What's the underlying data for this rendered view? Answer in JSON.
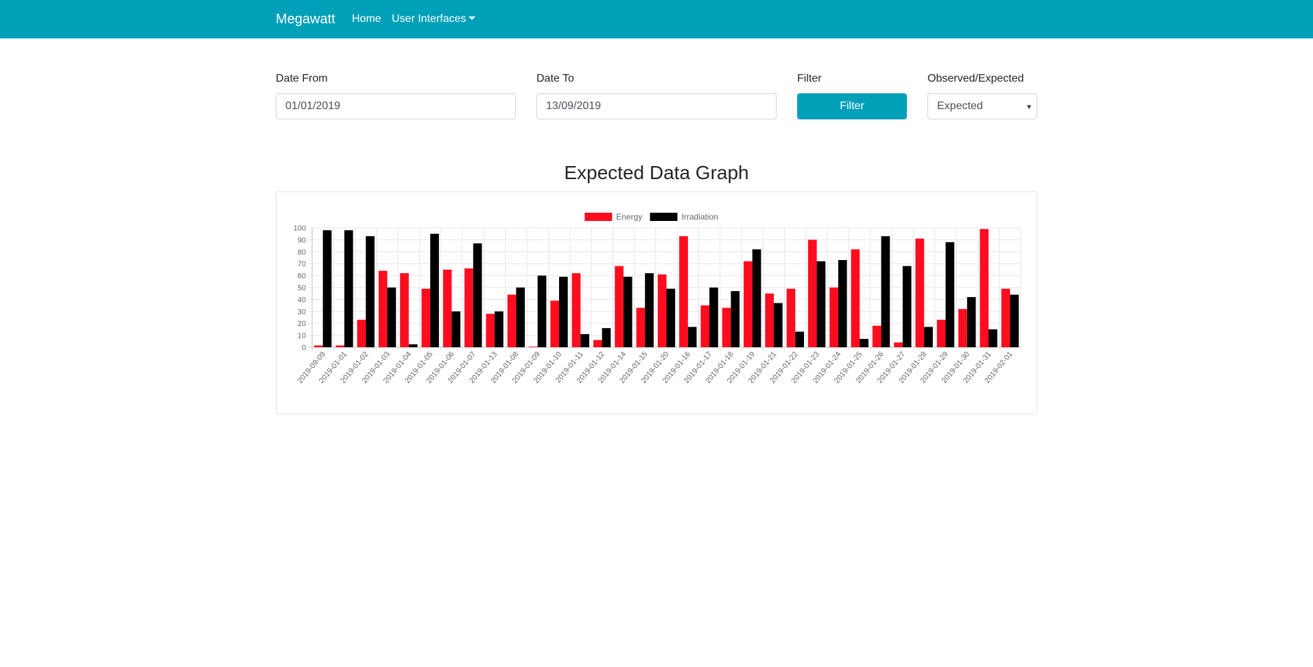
{
  "navbar": {
    "brand": "Megawatt",
    "home": "Home",
    "user_interfaces": "User Interfaces"
  },
  "form": {
    "date_from_label": "Date From",
    "date_from_value": "01/01/2019",
    "date_to_label": "Date To",
    "date_to_value": "13/09/2019",
    "filter_label": "Filter",
    "filter_button": "Filter",
    "mode_label": "Observed/Expected",
    "mode_value": "Expected"
  },
  "graph": {
    "title": "Expected Data Graph"
  },
  "colors": {
    "navbar": "#00a0b8",
    "energy": "#ff0d1e",
    "irradiation": "#000000"
  },
  "chart_data": {
    "type": "bar",
    "title": "",
    "xlabel": "",
    "ylabel": "",
    "ylim": [
      0,
      100
    ],
    "yticks": [
      0,
      10,
      20,
      30,
      40,
      50,
      60,
      70,
      80,
      90,
      100
    ],
    "grid": true,
    "legend_position": "top",
    "categories": [
      "2019-09-09",
      "2019-01-01",
      "2019-01-02",
      "2019-01-03",
      "2019-01-04",
      "2019-01-05",
      "2019-01-06",
      "2019-01-07",
      "2019-01-13",
      "2019-01-08",
      "2019-01-09",
      "2019-01-10",
      "2019-01-11",
      "2019-01-12",
      "2019-01-14",
      "2019-01-15",
      "2019-01-20",
      "2019-01-16",
      "2019-01-17",
      "2019-01-18",
      "2019-01-19",
      "2019-01-21",
      "2019-01-22",
      "2019-01-23",
      "2019-01-24",
      "2019-01-25",
      "2019-01-26",
      "2019-01-27",
      "2019-01-28",
      "2019-01-29",
      "2019-01-30",
      "2019-01-31",
      "2019-02-01"
    ],
    "series": [
      {
        "name": "Energy",
        "color": "#ff0d1e",
        "values": [
          1.5,
          1.5,
          23,
          64,
          62,
          49,
          65,
          66,
          28,
          44,
          0.5,
          39,
          62,
          6,
          68,
          33,
          61,
          93,
          35,
          33,
          72,
          45,
          49,
          90,
          50,
          82,
          18,
          4,
          91,
          23,
          32,
          99,
          49
        ]
      },
      {
        "name": "Irradiation",
        "color": "#000000",
        "values": [
          98,
          98,
          93,
          50,
          2.5,
          95,
          30,
          87,
          30,
          50,
          60,
          59,
          11,
          16,
          59,
          62,
          49,
          17,
          50,
          47,
          82,
          37,
          13,
          72,
          73,
          7,
          93,
          68,
          17,
          88,
          42,
          15,
          44
        ]
      }
    ]
  }
}
